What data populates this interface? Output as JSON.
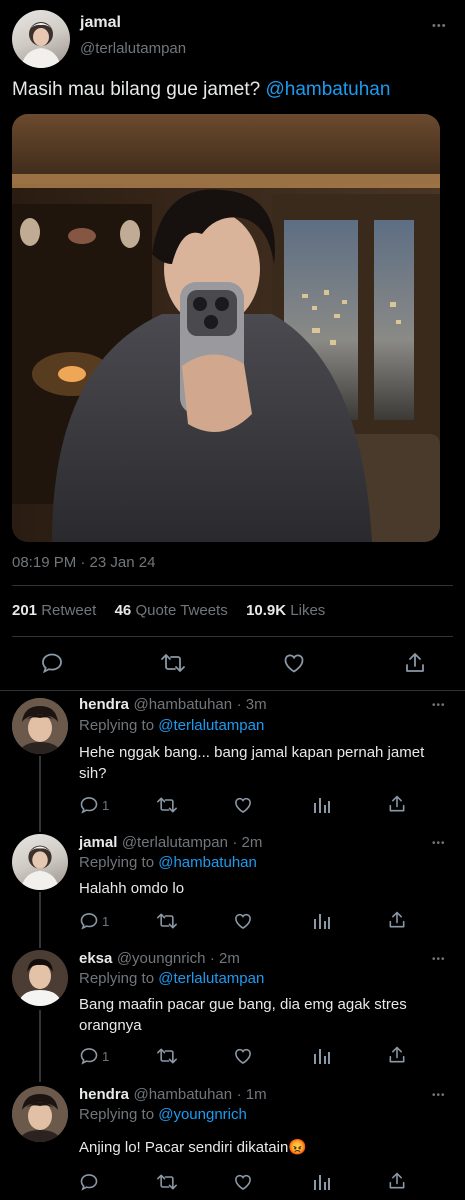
{
  "tweet": {
    "name": "jamal",
    "handle": "@terlalutampan",
    "text": "Masih mau bilang gue jamet? ",
    "mention": "@hambatuhan",
    "timestamp": "08:19 PM · 23 Jan 24",
    "stats": {
      "retweets_count": "201",
      "retweets_label": "Retweet",
      "quotes_count": "46",
      "quotes_label": "Quote Tweets",
      "likes_count": "10.9K",
      "likes_label": "Likes"
    },
    "more_glyph": "•••"
  },
  "replies": [
    {
      "name": "hendra",
      "handle": "@hambatuhan",
      "time": "· 3m",
      "replying_prefix": "Replying to ",
      "replying_to": "@terlalutampan",
      "text": "Hehe nggak bang... bang jamal kapan pernah jamet sih?",
      "reply_count": "1",
      "avatar_color": "#5a4a3e"
    },
    {
      "name": "jamal",
      "handle": "@terlalutampan",
      "time": "· 2m",
      "replying_prefix": "Replying to ",
      "replying_to": "@hambatuhan",
      "text": "Halahh omdo lo",
      "reply_count": "1",
      "avatar_color": "#d8d6d2"
    },
    {
      "name": "eksa",
      "handle": "@youngnrich",
      "time": "· 2m",
      "replying_prefix": "Replying to ",
      "replying_to": "@terlalutampan",
      "text": "Bang maafin pacar gue bang, dia emg agak stres orangnya",
      "reply_count": "1",
      "avatar_color": "#3a2f2a"
    },
    {
      "name": "hendra",
      "handle": "@hambatuhan",
      "time": "· 1m",
      "replying_prefix": "Replying to ",
      "replying_to": "@youngnrich",
      "text": "Anjing lo! Pacar sendiri dikatain😡",
      "reply_count": "",
      "avatar_color": "#5a4a3e"
    }
  ],
  "colors": {
    "background": "#000000",
    "accent": "#1d9bf0",
    "muted": "#71767b",
    "divider": "#2f3336"
  }
}
